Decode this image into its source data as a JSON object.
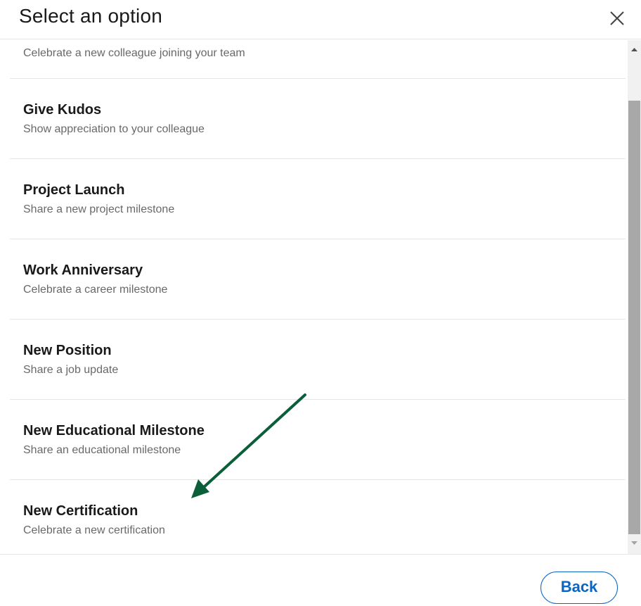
{
  "dialog": {
    "title": "Select an option",
    "close_icon": "close-icon"
  },
  "options": [
    {
      "label": "",
      "description": "Celebrate a new colleague joining your team"
    },
    {
      "label": "Give Kudos",
      "description": "Show appreciation to your colleague"
    },
    {
      "label": "Project Launch",
      "description": "Share a new project milestone"
    },
    {
      "label": "Work Anniversary",
      "description": "Celebrate a career milestone"
    },
    {
      "label": "New Position",
      "description": "Share a job update"
    },
    {
      "label": "New Educational Milestone",
      "description": "Share an educational milestone"
    },
    {
      "label": "New Certification",
      "description": "Celebrate a new certification"
    }
  ],
  "scrollbar": {
    "up_icon": "scroll-up-arrow-icon",
    "down_icon": "scroll-down-arrow-icon"
  },
  "footer": {
    "back_label": "Back"
  },
  "annotation": {
    "arrow_icon": "annotation-arrow-icon",
    "color": "#0b5e3a"
  },
  "colors": {
    "accent": "#0a66c2",
    "divider": "#e6e6e6",
    "scroll_thumb": "#a8a8a8"
  }
}
